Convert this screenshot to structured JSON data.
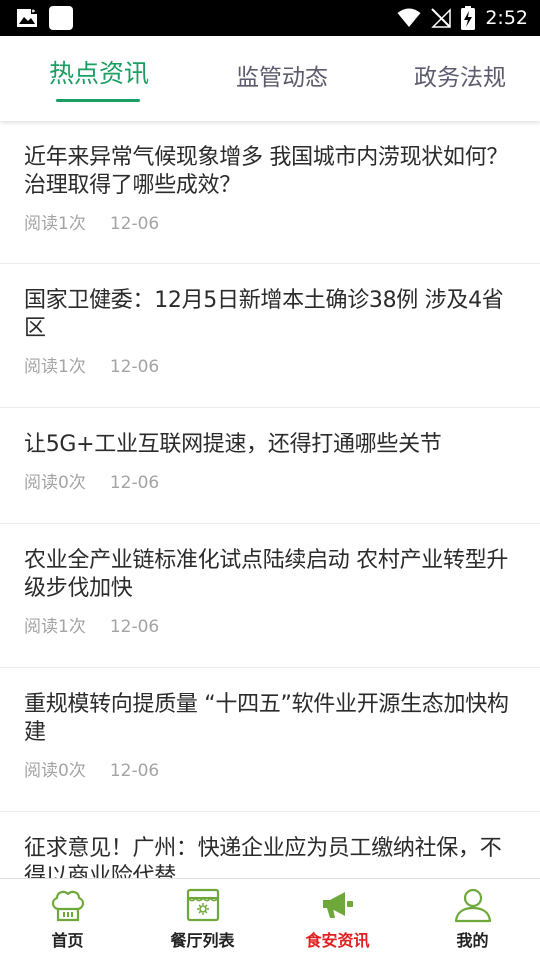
{
  "status_bar": {
    "time": "2:52",
    "icons": [
      "image-notification-icon",
      "blank-notification-icon",
      "wifi-icon",
      "no-signal-icon",
      "battery-charging-icon"
    ]
  },
  "tabs": [
    {
      "label": "热点资讯",
      "active": true
    },
    {
      "label": "监管动态",
      "active": false
    },
    {
      "label": "政务法规",
      "active": false
    }
  ],
  "news": [
    {
      "title": "近年来异常气候现象增多 我国城市内涝现状如何？治理取得了哪些成效？",
      "reads": "阅读1次",
      "date": "12-06"
    },
    {
      "title": "国家卫健委：12月5日新增本土确诊38例 涉及4省区",
      "reads": "阅读1次",
      "date": "12-06"
    },
    {
      "title": "让5G+工业互联网提速，还得打通哪些关节",
      "reads": "阅读0次",
      "date": "12-06"
    },
    {
      "title": "农业全产业链标准化试点陆续启动 农村产业转型升级步伐加快",
      "reads": "阅读1次",
      "date": "12-06"
    },
    {
      "title": "重规模转向提质量 “十四五”软件业开源生态加快构建",
      "reads": "阅读0次",
      "date": "12-06"
    },
    {
      "title": "征求意见！广州：快递企业应为员工缴纳社保，不得以商业险代替",
      "reads": "",
      "date": ""
    }
  ],
  "bottom_nav": [
    {
      "label": "首页",
      "icon": "chef-hat-icon",
      "active": false
    },
    {
      "label": "餐厅列表",
      "icon": "restaurant-store-icon",
      "active": false
    },
    {
      "label": "食安资讯",
      "icon": "megaphone-icon",
      "active": true
    },
    {
      "label": "我的",
      "icon": "user-profile-icon",
      "active": false
    }
  ],
  "colors": {
    "accent_green": "#1a9e62",
    "active_nav_red": "#e02020",
    "nav_icon_green": "#6fa83a"
  }
}
